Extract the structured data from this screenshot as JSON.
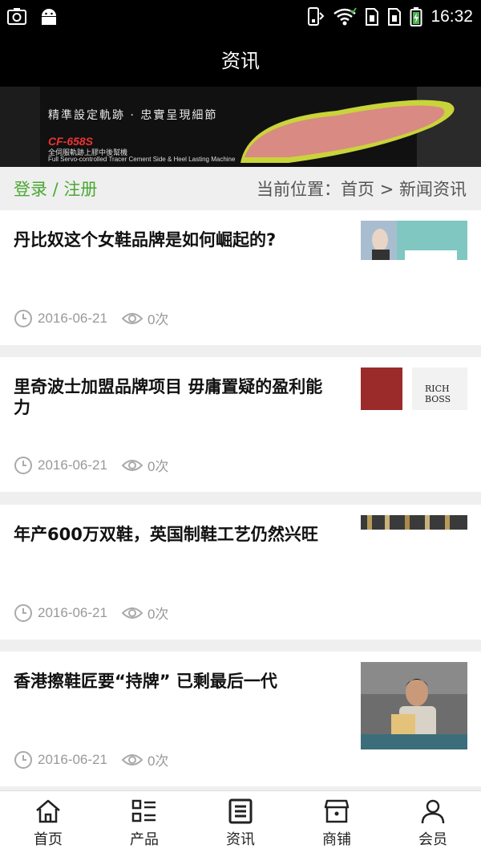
{
  "status_bar": {
    "time": "16:32"
  },
  "header": {
    "title": "资讯"
  },
  "banner": {
    "tagline": "精準設定軌跡 · 忠實呈現細節",
    "model": "CF-658S",
    "subtitle_cn": "全伺服軌跡上膠中後幫機",
    "subtitle_en": "Full Servo-controlled Tracer Cement Side & Heel Lasting Machine"
  },
  "breadcrumb": {
    "login": "登录 / 注册",
    "location": "当前位置：首页 > 新闻资讯"
  },
  "news": [
    {
      "title": "丹比奴这个女鞋品牌是如何崛起的?",
      "date": "2016-06-21",
      "views": "0次"
    },
    {
      "title": "里奇波士加盟品牌项目 毋庸置疑的盈利能力",
      "date": "2016-06-21",
      "views": "0次",
      "thumb_text": "RICH BOSS"
    },
    {
      "title": "年产600万双鞋，英国制鞋工艺仍然兴旺",
      "date": "2016-06-21",
      "views": "0次"
    },
    {
      "title": "香港擦鞋匠要“持牌” 已剩最后一代",
      "date": "2016-06-21",
      "views": "0次"
    }
  ],
  "bottom_nav": [
    {
      "label": "首页",
      "icon": "home-icon"
    },
    {
      "label": "产品",
      "icon": "list-icon"
    },
    {
      "label": "资讯",
      "icon": "news-icon"
    },
    {
      "label": "商铺",
      "icon": "shop-icon"
    },
    {
      "label": "会员",
      "icon": "user-icon"
    }
  ],
  "colors": {
    "accent_green": "#4aa832",
    "header_bg": "#000000"
  }
}
